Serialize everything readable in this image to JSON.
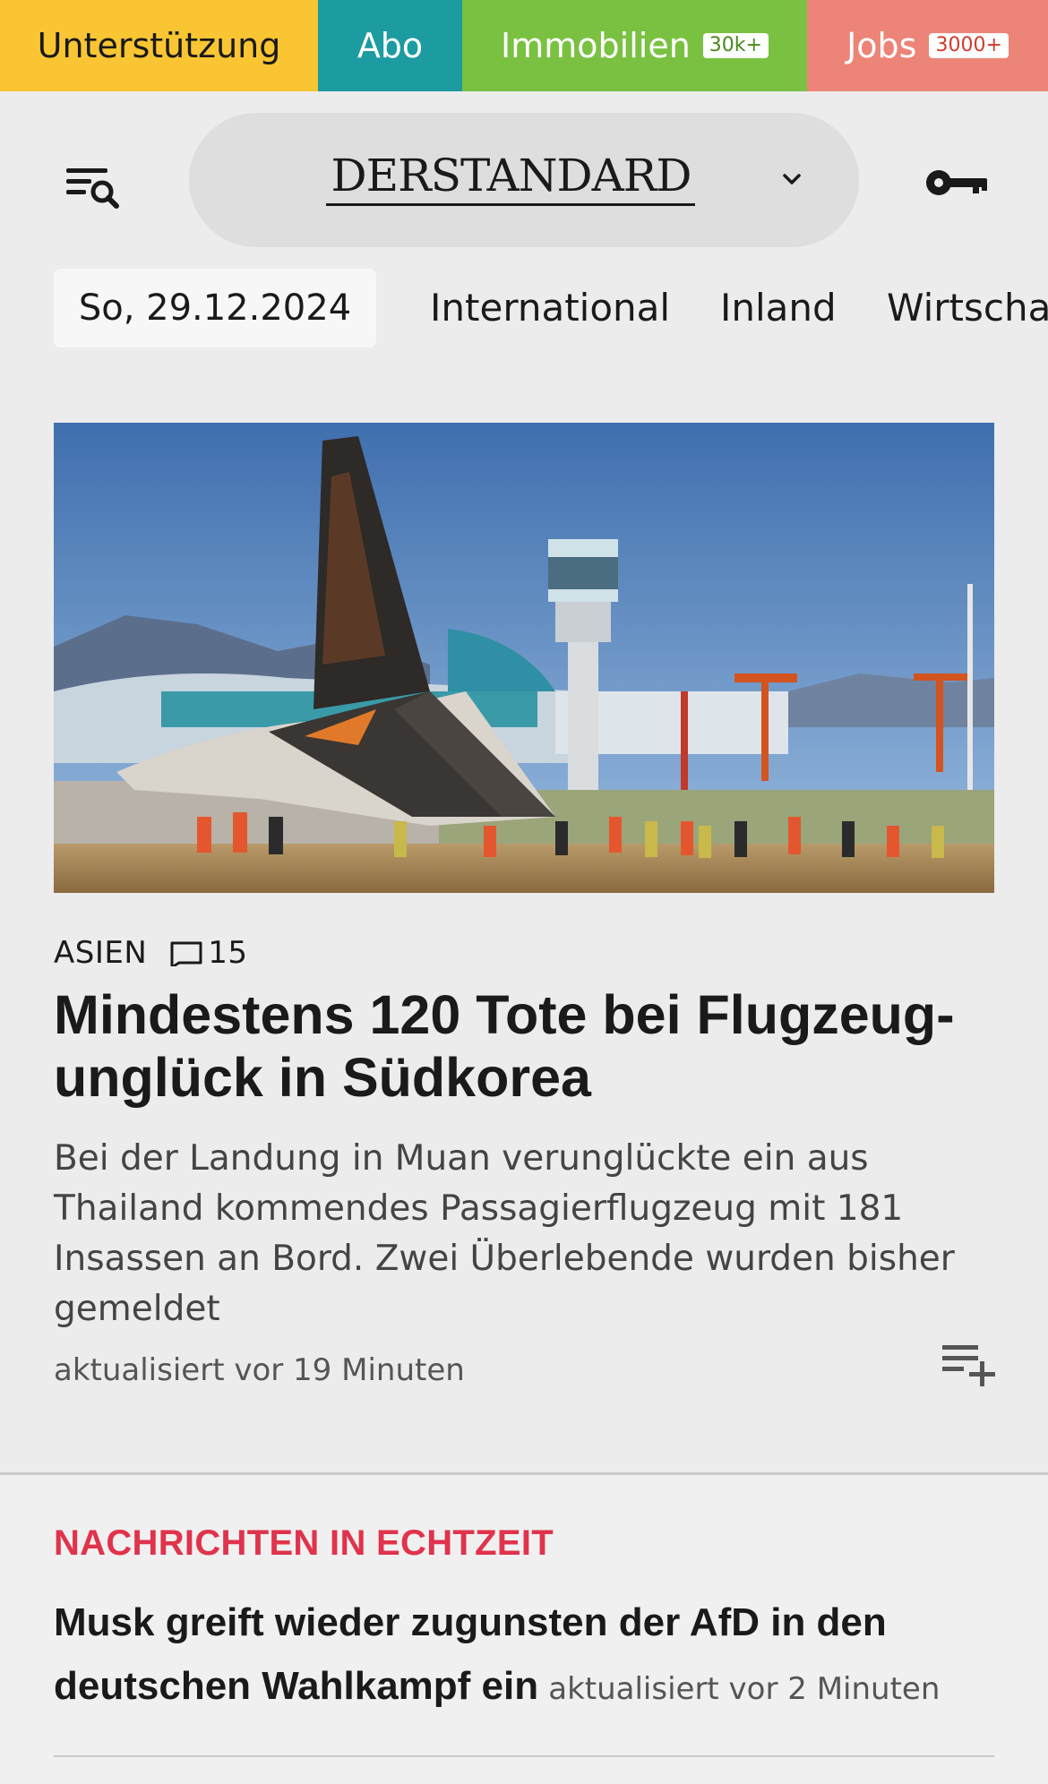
{
  "promo": {
    "support": "Unterstützung",
    "abo": "Abo",
    "immobilien": "Immobilien",
    "immobilien_badge": "30k+",
    "jobs": "Jobs",
    "jobs_badge": "3000+"
  },
  "header": {
    "logo": "DERSTANDARD",
    "menu_icon": "menu-search-icon",
    "account_icon": "key-icon",
    "chevron_icon": "chevron-down-icon"
  },
  "nav": {
    "date": "So, 29.12.2024",
    "links": [
      "International",
      "Inland",
      "Wirtschaft"
    ]
  },
  "lead_article": {
    "image_alt": "Flugzeugwrack am Flughafen Muan mit Rettungskräften",
    "kicker": "ASIEN",
    "comments": "15",
    "headline": "Mindestens 120 Tote bei Flugzeug­unglück in Südkorea",
    "teaser": "Bei der Landung in Muan verunglückte ein aus Thailand kommendes Passagierflugzeug mit 181 Insassen an Bord. Zwei Überlebende wurden bisher gemeldet",
    "timestamp": "aktualisiert vor 19 Minuten",
    "add_icon": "playlist-add-icon"
  },
  "live": {
    "label": "NACHRICHTEN IN ECHTZEIT",
    "items": [
      {
        "title": "Musk greift wieder zugunsten der AfD in den deutschen Wahlkampf ein",
        "time": "aktualisiert vor 2 Minuten"
      }
    ]
  },
  "colors": {
    "support": "#f9c532",
    "abo": "#1c9ba1",
    "immobilien": "#7ac142",
    "jobs": "#ec8478",
    "live_label": "#e0334c"
  }
}
